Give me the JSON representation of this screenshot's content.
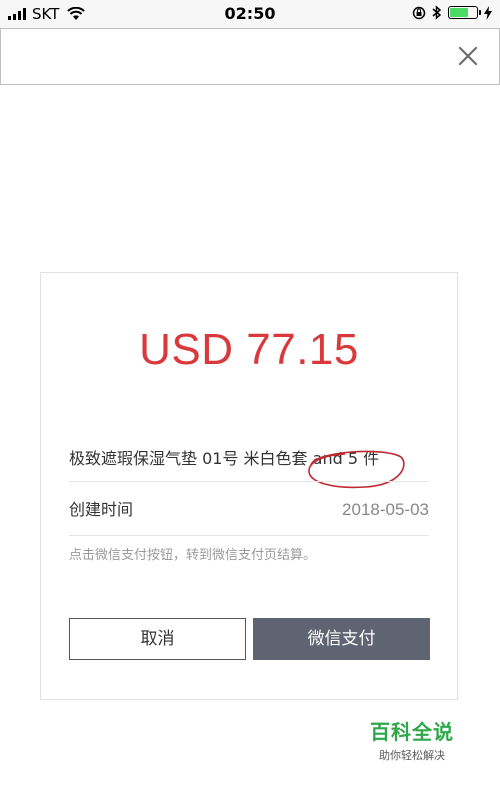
{
  "status_bar": {
    "carrier": "SKT",
    "time": "02:50",
    "battery_level": 0.7
  },
  "header": {
    "close_icon": "close-icon"
  },
  "payment": {
    "amount": "USD 77.15",
    "product_name": "极致遮瑕保湿气垫 01号 米白色套",
    "product_more": "and 5 件",
    "created_label": "创建时间",
    "created_date": "2018-05-03",
    "note": "点击微信支付按钮，转到微信支付页结算。",
    "cancel_label": "取消",
    "pay_label": "微信支付"
  },
  "watermark": {
    "title": "百科全说",
    "subtitle": "助你轻松解决"
  },
  "colors": {
    "amount": "#d9393b",
    "pay_button": "#5e6471",
    "annotation": "#c0282e",
    "watermark": "#2ea84a"
  }
}
